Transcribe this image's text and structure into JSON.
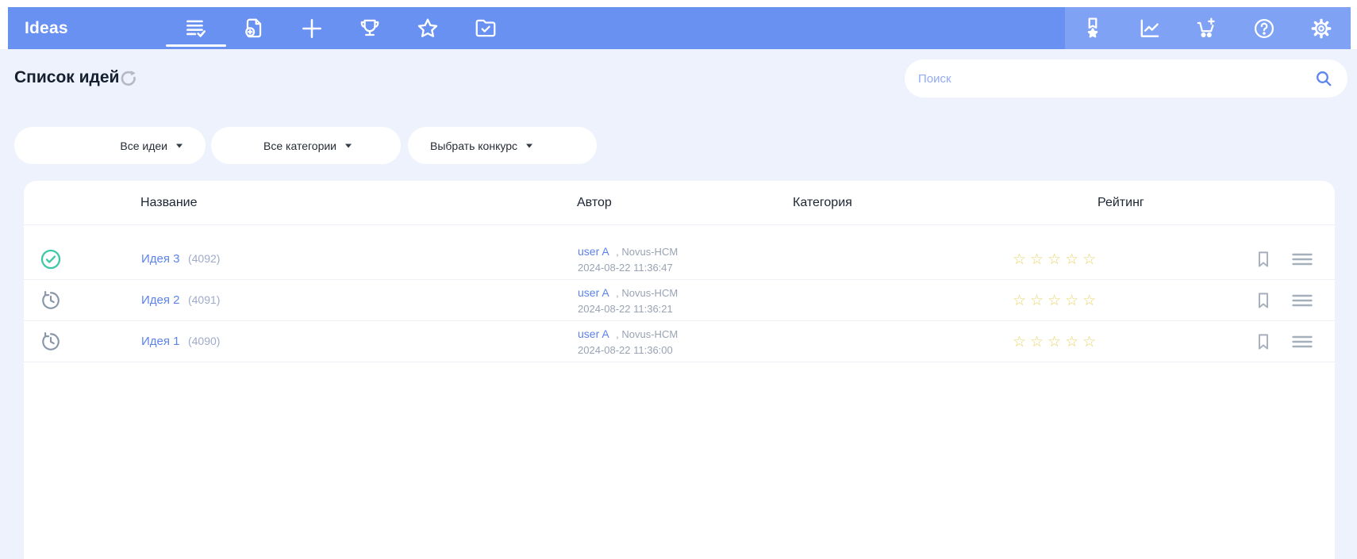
{
  "app": {
    "name": "Ideas"
  },
  "topbar": {
    "nav_icons": [
      "list-check-icon",
      "file-plus-icon",
      "plus-icon",
      "trophy-icon",
      "star-icon",
      "folder-check-icon"
    ],
    "active_nav_index": 0,
    "utility_icons": [
      "medal-icon",
      "line-chart-icon",
      "cart-plus-icon",
      "help-circle-icon",
      "gear-icon"
    ]
  },
  "page": {
    "title": "Список идей"
  },
  "search": {
    "placeholder": "Поиск",
    "value": ""
  },
  "filters": [
    {
      "label": "Все идеи"
    },
    {
      "label": "Все категории"
    },
    {
      "label": "Выбрать конкурс"
    }
  ],
  "table": {
    "columns": [
      "Название",
      "Автор",
      "Категория",
      "Рейтинг"
    ],
    "rows": [
      {
        "status": "approved",
        "title": "Идея 3",
        "id": "(4092)",
        "author": "user A",
        "org": ", Novus-HCM",
        "date": "2024-08-22 11:36:47",
        "category": "",
        "rating": 0,
        "rating_max": 5
      },
      {
        "status": "history",
        "title": "Идея 2",
        "id": "(4091)",
        "author": "user A",
        "org": ", Novus-HCM",
        "date": "2024-08-22 11:36:21",
        "category": "",
        "rating": 0,
        "rating_max": 5
      },
      {
        "status": "history",
        "title": "Идея 1",
        "id": "(4090)",
        "author": "user A",
        "org": ", Novus-HCM",
        "date": "2024-08-22 11:36:00",
        "category": "",
        "rating": 0,
        "rating_max": 5
      }
    ]
  },
  "colors": {
    "topbar": "#6991f2",
    "topbar_light": "#7fa2f4",
    "background": "#edf2fc",
    "link": "#5b83ea",
    "star": "#e9d66b",
    "status_approved": "#3fc8a4",
    "muted_icon": "#a6afbc"
  }
}
